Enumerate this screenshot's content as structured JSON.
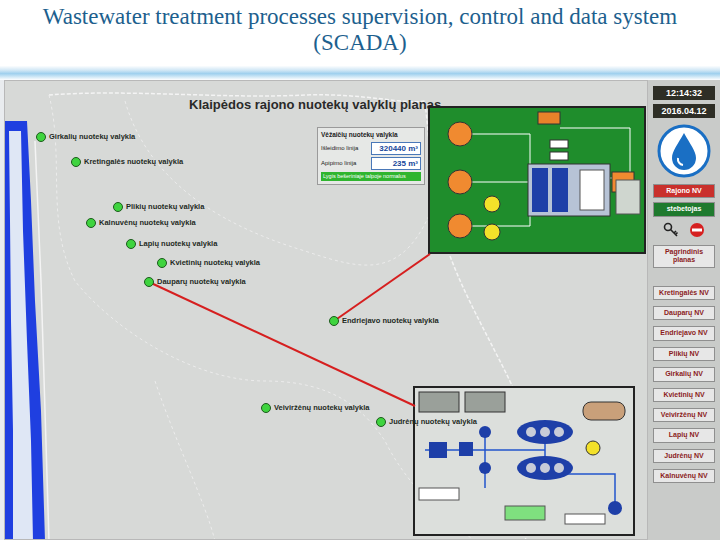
{
  "slide": {
    "title": "Wastewater treatment processes supervision, control and data system (SCADA)"
  },
  "map": {
    "title": "Klaipėdos rajono nuotekų valyklų planas",
    "stations": [
      {
        "name": "Girkalių nuotekų valykla",
        "on": true
      },
      {
        "name": "Kretingalės nuotekų valykla",
        "on": true
      },
      {
        "name": "Plikių nuotekų valykla",
        "on": true
      },
      {
        "name": "Kalnuvėnų nuotekų valykla",
        "on": true
      },
      {
        "name": "Lapių nuotekų valykla",
        "on": true
      },
      {
        "name": "Kvietinių nuotekų valykla",
        "on": true
      },
      {
        "name": "Dauparų nuotekų valykla",
        "on": true
      },
      {
        "name": "Endriejavo nuotekų valykla",
        "on": true
      },
      {
        "name": "Veiviržėnų nuotekų valykla",
        "on": true
      },
      {
        "name": "Judrėnų nuotekų valykla",
        "on": true
      }
    ]
  },
  "info_box": {
    "title": "Vėžaičių nuotekų valykla",
    "rows": [
      {
        "label": "Išleidimo linija",
        "value": "320440 m³"
      },
      {
        "label": "Apipimo linija",
        "value": "235 m³"
      }
    ],
    "status": "Lygis bešeriniaje talpoje normalus"
  },
  "sidebar": {
    "time": "12:14:32",
    "date": "2016.04.12",
    "view": {
      "label": "Rajono NV",
      "selected": true
    },
    "user": "stebetojas",
    "main_button": "Pagrindinis planas",
    "plants": [
      {
        "label": "Kretingalės NV",
        "selected": false
      },
      {
        "label": "Dauparų NV",
        "selected": false
      },
      {
        "label": "Endriejavo NV",
        "selected": false
      },
      {
        "label": "Plikių NV",
        "selected": false
      },
      {
        "label": "Girkalių NV",
        "selected": false
      },
      {
        "label": "Kvietinių NV",
        "selected": false
      },
      {
        "label": "Veiviržėnų NV",
        "selected": false
      },
      {
        "label": "Lapių NV",
        "selected": false
      },
      {
        "label": "Judrėnų NV",
        "selected": false
      },
      {
        "label": "Kalnuvėnų NV",
        "selected": false
      }
    ]
  }
}
